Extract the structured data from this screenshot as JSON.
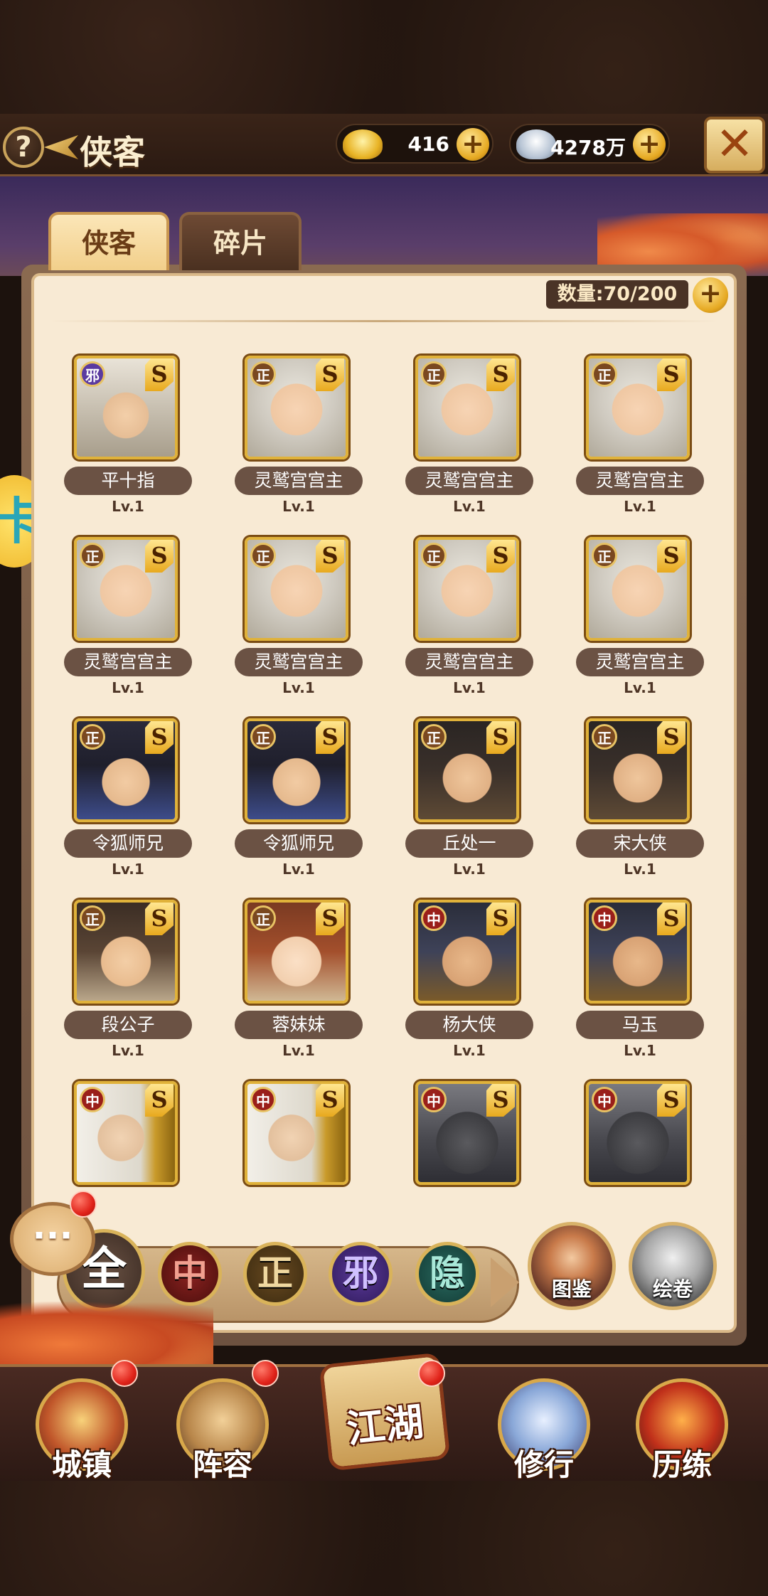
{
  "header": {
    "help": "?",
    "title": "侠客",
    "gold": "416",
    "silver": "4278万",
    "plus": "+",
    "close": "✕"
  },
  "side_badge": "卡",
  "tabs": [
    {
      "label": "侠客",
      "active": true
    },
    {
      "label": "碎片",
      "active": false
    }
  ],
  "count_label": "数量:70/200",
  "heroes": [
    {
      "name": "平十指",
      "level": "Lv.1",
      "faction": "邪",
      "grade": "S",
      "portrait": "old-master"
    },
    {
      "name": "灵鹫宫宫主",
      "level": "Lv.1",
      "faction": "正",
      "grade": "S",
      "portrait": "bald-monk"
    },
    {
      "name": "灵鹫宫宫主",
      "level": "Lv.1",
      "faction": "正",
      "grade": "S",
      "portrait": "bald-monk"
    },
    {
      "name": "灵鹫宫宫主",
      "level": "Lv.1",
      "faction": "正",
      "grade": "S",
      "portrait": "bald-monk"
    },
    {
      "name": "灵鹫宫宫主",
      "level": "Lv.1",
      "faction": "正",
      "grade": "S",
      "portrait": "bald-monk"
    },
    {
      "name": "灵鹫宫宫主",
      "level": "Lv.1",
      "faction": "正",
      "grade": "S",
      "portrait": "bald-monk"
    },
    {
      "name": "灵鹫宫宫主",
      "level": "Lv.1",
      "faction": "正",
      "grade": "S",
      "portrait": "bald-monk"
    },
    {
      "name": "灵鹫宫宫主",
      "level": "Lv.1",
      "faction": "正",
      "grade": "S",
      "portrait": "bald-monk"
    },
    {
      "name": "令狐师兄",
      "level": "Lv.1",
      "faction": "正",
      "grade": "S",
      "portrait": "hat-swordsman"
    },
    {
      "name": "令狐师兄",
      "level": "Lv.1",
      "faction": "正",
      "grade": "S",
      "portrait": "hat-swordsman"
    },
    {
      "name": "丘处一",
      "level": "Lv.1",
      "faction": "正",
      "grade": "S",
      "portrait": "dark-hair"
    },
    {
      "name": "宋大侠",
      "level": "Lv.1",
      "faction": "正",
      "grade": "S",
      "portrait": "dark-hair"
    },
    {
      "name": "段公子",
      "level": "Lv.1",
      "faction": "正",
      "grade": "S",
      "portrait": "brown-hair"
    },
    {
      "name": "蓉妹妹",
      "level": "Lv.1",
      "faction": "正",
      "grade": "S",
      "portrait": "girl"
    },
    {
      "name": "杨大侠",
      "level": "Lv.1",
      "faction": "中",
      "grade": "S",
      "portrait": "warrior"
    },
    {
      "name": "马玉",
      "level": "Lv.1",
      "faction": "中",
      "grade": "S",
      "portrait": "warrior"
    },
    {
      "name": "",
      "level": "",
      "faction": "中",
      "grade": "S",
      "portrait": "gold-elder"
    },
    {
      "name": "",
      "level": "",
      "faction": "中",
      "grade": "S",
      "portrait": "gold-elder"
    },
    {
      "name": "",
      "level": "",
      "faction": "中",
      "grade": "S",
      "portrait": "masked"
    },
    {
      "name": "",
      "level": "",
      "faction": "中",
      "grade": "S",
      "portrait": "masked"
    }
  ],
  "filters": [
    "全",
    "中",
    "正",
    "邪",
    "隐"
  ],
  "catalog_label": "图鉴",
  "scroll_label": "绘卷",
  "chat_icon": "···",
  "nav": [
    "城镇",
    "阵容",
    "江湖",
    "修行",
    "历练"
  ],
  "colors": {
    "panel": "#f8ead4",
    "name_plate": "#6b5244",
    "gold_border": "#e0b23a",
    "red_dot": "#e0231a"
  }
}
